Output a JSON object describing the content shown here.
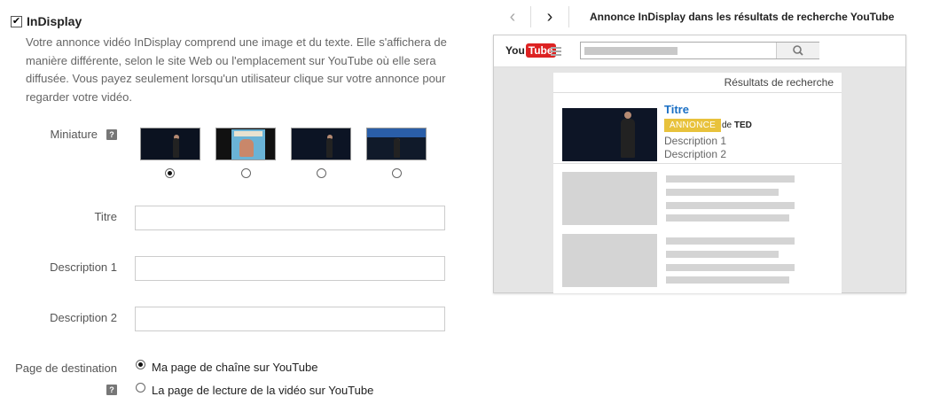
{
  "form": {
    "checkbox_label": "InDisplay",
    "description": "Votre annonce vidéo InDisplay comprend une image et du texte. Elle s'affichera de manière différente, selon le site Web ou l'emplacement sur YouTube où elle sera diffusée. Vous payez seulement lorsqu'un utilisateur clique sur votre annonce pour regarder votre vidéo.",
    "miniature_label": "Miniature",
    "help_glyph": "?",
    "thumbnails_selected_index": 0,
    "titre_label": "Titre",
    "titre_value": "",
    "description1_label": "Description 1",
    "description1_value": "",
    "description2_label": "Description 2",
    "description2_value": "",
    "destination_label": "Page de destination",
    "destination_options": [
      "Ma page de chaîne sur YouTube",
      "La page de lecture de la vidéo sur YouTube"
    ],
    "destination_selected_index": 0
  },
  "preview": {
    "prev_icon": "chevron-left-icon",
    "next_icon": "chevron-right-icon",
    "title": "Annonce InDisplay dans les résultats de recherche YouTube",
    "logo_you": "You",
    "logo_tube": "Tube",
    "results_header": "Résultats de recherche",
    "ad_title": "Titre",
    "ad_badge": "ANNONCE",
    "ad_by_prefix": "de",
    "ad_channel": "TED",
    "ad_desc1": "Description 1",
    "ad_desc2": "Description 2"
  },
  "colors": {
    "link_blue": "#1a6fc4",
    "badge_yellow": "#e8c23c",
    "youtube_red": "#dd2222"
  }
}
